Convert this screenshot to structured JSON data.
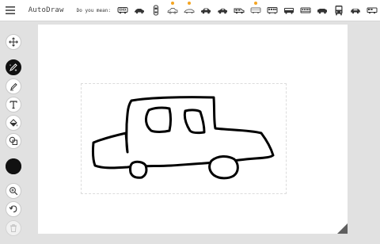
{
  "header": {
    "menu_icon": "hamburger-menu-icon",
    "app_name": "AutoDraw",
    "suggest_label": "Do you mean:",
    "suggestions": [
      {
        "name": "car-bus-icon",
        "dot": false
      },
      {
        "name": "car-sedan-icon",
        "dot": false
      },
      {
        "name": "car-top-view-icon",
        "dot": false
      },
      {
        "name": "car-sketch-icon",
        "dot": true
      },
      {
        "name": "car-sport-icon",
        "dot": true
      },
      {
        "name": "car-hatch-icon",
        "dot": false
      },
      {
        "name": "car-coupe-icon",
        "dot": false
      },
      {
        "name": "car-van-icon",
        "dot": false
      },
      {
        "name": "car-outline-icon",
        "dot": true
      },
      {
        "name": "bus-icon",
        "dot": false
      },
      {
        "name": "bus-side-icon",
        "dot": false
      },
      {
        "name": "train-icon",
        "dot": false
      },
      {
        "name": "truck-icon",
        "dot": false
      },
      {
        "name": "bus-front-icon",
        "dot": false
      },
      {
        "name": "car-front-icon",
        "dot": false
      },
      {
        "name": "car-wagon-icon",
        "dot": false
      }
    ],
    "dot_color": "#f4a522"
  },
  "toolbar": {
    "tools": [
      {
        "name": "move-tool",
        "icon": "move-arrows-icon",
        "active": false
      },
      {
        "name": "autodraw-tool",
        "icon": "autodraw-pencil-icon",
        "active": true
      },
      {
        "name": "draw-tool",
        "icon": "pencil-icon",
        "active": false
      },
      {
        "name": "type-tool",
        "icon": "text-icon",
        "active": false
      },
      {
        "name": "fill-tool",
        "icon": "paint-bucket-icon",
        "active": false
      },
      {
        "name": "shape-tool",
        "icon": "shapes-icon",
        "active": false
      },
      {
        "name": "color-tool",
        "icon": "color-swatch-icon",
        "color": "#111111"
      },
      {
        "name": "zoom-tool",
        "icon": "zoom-in-icon",
        "active": false
      },
      {
        "name": "undo-tool",
        "icon": "undo-icon",
        "active": false
      },
      {
        "name": "delete-tool",
        "icon": "trash-icon",
        "disabled": true
      }
    ]
  },
  "canvas": {
    "drawing": "car-doodle"
  }
}
